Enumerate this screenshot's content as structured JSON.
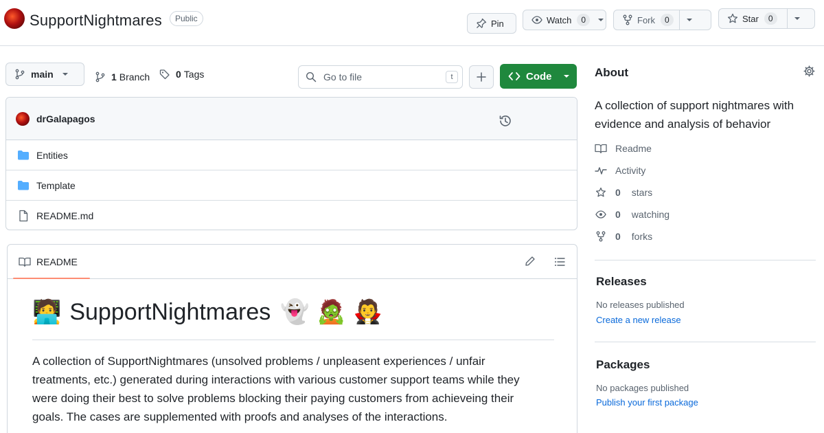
{
  "repo": {
    "name": "SupportNightmares",
    "visibility": "Public"
  },
  "header_actions": {
    "pin_label": "Pin",
    "watch_label": "Watch",
    "watch_count": "0",
    "fork_label": "Fork",
    "fork_count": "0",
    "star_label": "Star",
    "star_count": "0"
  },
  "toolbar": {
    "branch": "main",
    "branch_count": "1",
    "branch_word": "Branch",
    "tag_count": "0",
    "tag_word": "Tags",
    "goto_placeholder": "Go to file",
    "goto_shortcut": "t",
    "code_label": "Code"
  },
  "latest_commit": {
    "author": "drGalapagos"
  },
  "files": [
    {
      "name": "Entities",
      "type": "folder"
    },
    {
      "name": "Template",
      "type": "folder"
    },
    {
      "name": "README.md",
      "type": "file"
    }
  ],
  "readme": {
    "tab_label": "README",
    "h1_emoji_before": "🧑‍💻",
    "h1_title": "SupportNightmares",
    "h1_emojis_after": "👻 🧟 🧛",
    "paragraph": "A collection of SupportNightmares (unsolved problems / unpleasent experiences / unfair treatments, etc.) generated during interactions with various customer support teams while they were doing their best to solve problems blocking their paying customers from achieveing their goals. The cases are supplemented with proofs and analyses of the interactions."
  },
  "about": {
    "heading": "About",
    "description": "A collection of support nightmares with evidence and analysis of behavior",
    "items": {
      "readme": "Readme",
      "activity": "Activity",
      "stars_count": "0",
      "stars_word": "stars",
      "watching_count": "0",
      "watching_word": "watching",
      "forks_count": "0",
      "forks_word": "forks"
    }
  },
  "releases": {
    "heading": "Releases",
    "empty_text": "No releases published",
    "create_link": "Create a new release"
  },
  "packages": {
    "heading": "Packages",
    "empty_text": "No packages published",
    "publish_link": "Publish your first package"
  },
  "colors": {
    "code_button": "#1f883d",
    "folder_icon": "#54aeff",
    "link": "#0969da",
    "tab_underline": "#fd8c73"
  }
}
